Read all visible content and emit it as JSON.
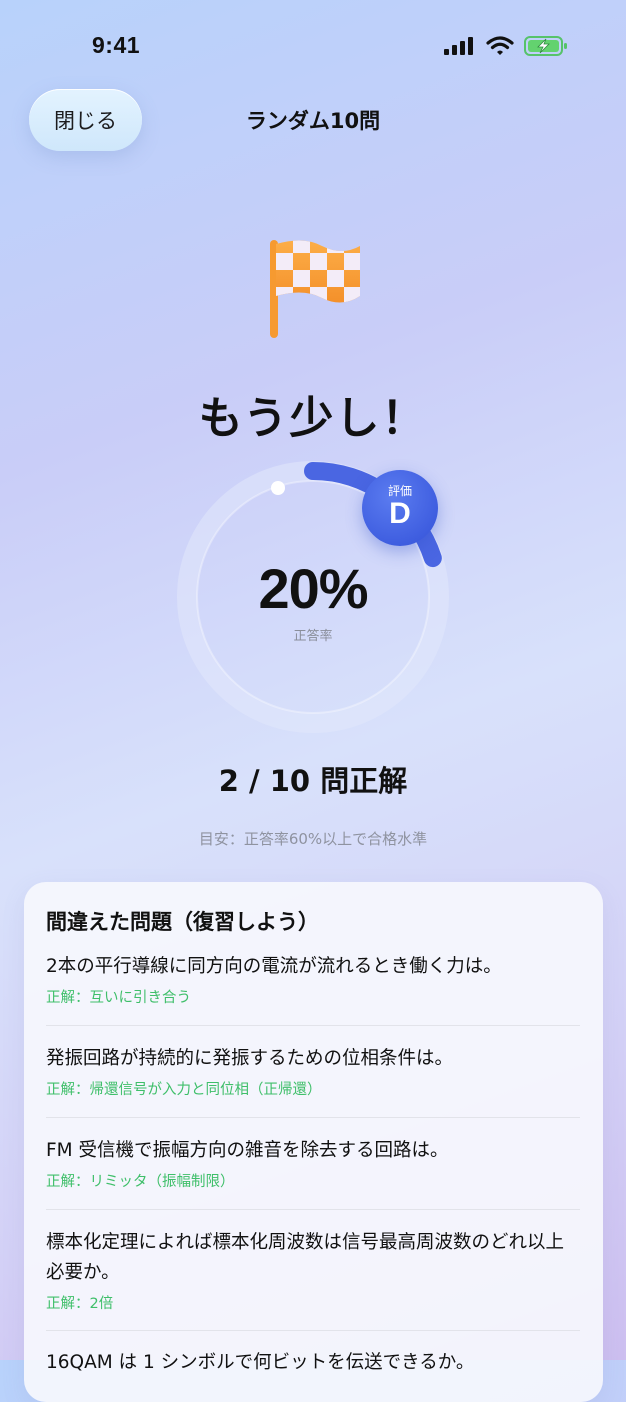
{
  "status_bar": {
    "time": "9:41"
  },
  "header": {
    "close_label": "閉じる",
    "title": "ランダム10問"
  },
  "result": {
    "headline": "もう少し！",
    "percent": "20%",
    "percent_label": "正答率",
    "grade_label": "評価",
    "grade": "D",
    "score": "2 / 10 問正解",
    "guide": "目安：正答率60%以上で合格水準",
    "accuracy_fraction": 0.2
  },
  "review": {
    "title": "間違えた問題（復習しよう）",
    "items": [
      {
        "question": "2本の平行導線に同方向の電流が流れるとき働く力は。",
        "answer": "正解：互いに引き合う"
      },
      {
        "question": "発振回路が持続的に発振するための位相条件は。",
        "answer": "正解：帰還信号が入力と同位相（正帰還）"
      },
      {
        "question": "FM 受信機で振幅方向の雑音を除去する回路は。",
        "answer": "正解：リミッタ（振幅制限）"
      },
      {
        "question": "標本化定理によれば標本化周波数は信号最高周波数のどれ以上必要か。",
        "answer": "正解：2倍"
      },
      {
        "question": "16QAM は 1 シンボルで何ビットを伝送できるか。",
        "answer": ""
      }
    ]
  },
  "colors": {
    "accent": "#3f5ee0",
    "correct": "#3fbf6a",
    "flag": "#f7942a"
  }
}
